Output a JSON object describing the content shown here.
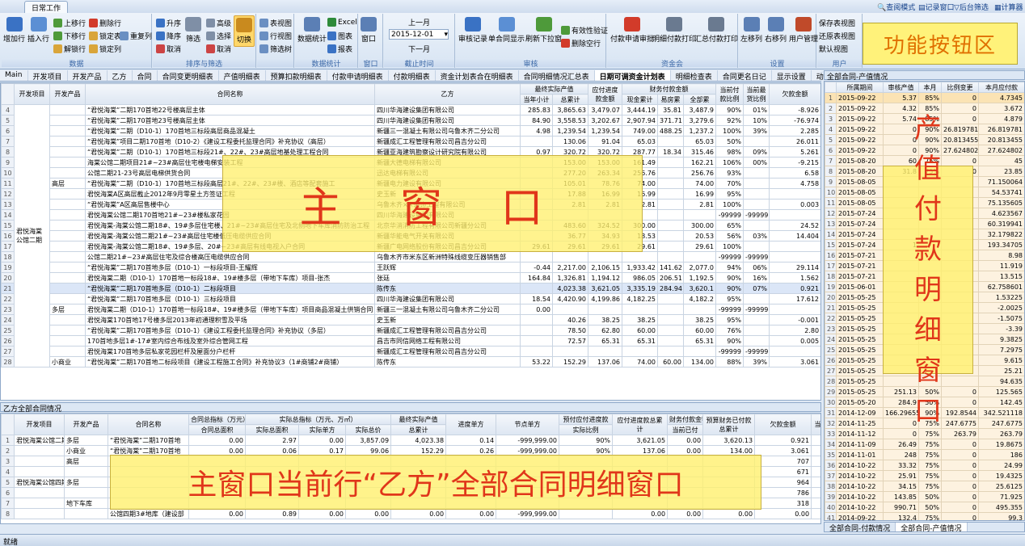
{
  "ribbon": {
    "tab": "日常工作",
    "quick": [
      "查阅模式",
      "记录窗口",
      "后台筛选",
      "计算器"
    ],
    "groups": [
      {
        "label": "数据",
        "buttons": [
          "增加行",
          "插入行",
          "上移行",
          "下移行",
          "解锁行",
          "删除行",
          "锁定表",
          "重复列",
          "锁定列"
        ]
      },
      {
        "label": "排序与筛选",
        "buttons": [
          "升序",
          "降序",
          "取消",
          "筛选",
          "取消",
          "高级",
          "选择",
          "取消",
          "切换"
        ]
      },
      {
        "label": "",
        "buttons": [
          "表视图",
          "行视图",
          "筛选树"
        ]
      },
      {
        "label": "数据统计",
        "buttons": [
          "数据统计",
          "Excel",
          "图表",
          "报表"
        ]
      },
      {
        "label": "窗口",
        "buttons": [
          "窗口"
        ]
      },
      {
        "label": "截止时间",
        "buttons": [
          "上一月",
          "2015-12-01",
          "下一月"
        ]
      },
      {
        "label": "审核",
        "buttons": [
          "审核记录",
          "单合同显示",
          "刷新下拉窗",
          "有效性验证",
          "删除空行"
        ]
      },
      {
        "label": "资金会",
        "buttons": [
          "付款申请审批",
          "明细付款打印",
          "汇总付款打印"
        ]
      },
      {
        "label": "设置",
        "buttons": [
          "左移列",
          "右移列",
          "用户管理"
        ]
      },
      {
        "label": "用户",
        "buttons": [
          "保存表视图",
          "还原表视图",
          "默认视图"
        ]
      }
    ],
    "zone_label": "功能按钮区"
  },
  "module_tabs": [
    "Main",
    "开发项目",
    "开发产品",
    "乙方",
    "合同",
    "合同变更明细表",
    "产值明细表",
    "预算扣款明细表",
    "付款申请明细表",
    "付款明细表",
    "资金计划表合在明细表",
    "合同明细情况汇总表",
    "日期可调资金计划表",
    "明细检查表",
    "合同更名日记",
    "显示设置",
    "动态更新下拉目…"
  ],
  "main": {
    "zone_label": "主 窗 口",
    "headers": {
      "project": "开发项目",
      "product": "开发产品",
      "contract": "合同名称",
      "partyb": "乙方",
      "output": "最终实际产值",
      "output_cur": "当年小计",
      "output_total": "总累计",
      "payable": "应付进度款金额",
      "fin": "财务付款金额",
      "fin_cash": "现金累计",
      "fin_easy": "易房累",
      "fin_total": "全部累",
      "ratio": "当前付款比例",
      "pre": "当前最货比例",
      "owed": "欠款金额"
    },
    "project": "君悦海棠公馆二期",
    "rows": [
      {
        "n": "4",
        "product": "",
        "contract": "“君悦海棠”二期170首地22号楼高层主体",
        "partyb": "四川华海建设集团有限公司",
        "cur": "285.83",
        "total": "3,865.63",
        "pay": "3,479.07",
        "cash": "3,444.19",
        "easy": "35.81",
        "all": "3,487.9",
        "ratio": "90%",
        "pre": "01%",
        "owed": "-8.926"
      },
      {
        "n": "5",
        "product": "",
        "contract": "“君悦海棠”二期170首地23号楼高层主体",
        "partyb": "四川华海建设集团有限公司",
        "cur": "84.90",
        "total": "3,558.53",
        "pay": "3,202.67",
        "cash": "2,907.94",
        "easy": "371.71",
        "all": "3,279.6",
        "ratio": "92%",
        "pre": "10%",
        "owed": "-76.974"
      },
      {
        "n": "6",
        "product": "",
        "contract": "“君悦海棠”二期（D10-1）170首地三标段高层商品混凝土",
        "partyb": "新疆三一混凝土有限公司乌鲁木齐二分公司",
        "cur": "4.98",
        "total": "1,239.54",
        "pay": "1,239.54",
        "cash": "749.00",
        "easy": "488.25",
        "all": "1,237.2",
        "ratio": "100%",
        "pre": "39%",
        "owed": "2.285"
      },
      {
        "n": "7",
        "product": "",
        "contract": "“君悦海棠”项目二期170首地（D10-2）《建设工程委托监理合同》补充协议（高层）",
        "partyb": "新疆成汇工程管理有限公司昌吉分公司",
        "cur": "",
        "total": "130.06",
        "pay": "91.04",
        "cash": "65.03",
        "easy": "",
        "all": "65.03",
        "ratio": "50%",
        "pre": "",
        "owed": "26.011"
      },
      {
        "n": "8",
        "product": "",
        "contract": "“君悦海棠”二期（D10-1）170首地三标段21#、22#、23#高层地基处理工程合同",
        "partyb": "新疆亚海建筑勘察设计研究院有限公司",
        "cur": "0.97",
        "total": "320.72",
        "pay": "320.72",
        "cash": "287.77",
        "easy": "18.34",
        "all": "315.46",
        "ratio": "98%",
        "pre": "09%",
        "owed": "5.261"
      },
      {
        "n": "9",
        "product": "",
        "contract": "海棠公馆二期项目21#~23#高层住宅楼电梯安装工程",
        "partyb": "新疆大德电梯有限公司",
        "cur": "",
        "total": "153.00",
        "pay": "153.00",
        "cash": "161.49",
        "easy": "",
        "all": "162.21",
        "ratio": "106%",
        "pre": "00%",
        "owed": "-9.215"
      },
      {
        "n": "10",
        "product": "",
        "contract": "公馆二期21-23号高层电梯供货合同",
        "partyb": "迅达电梯有限公司",
        "cur": "",
        "total": "277.20",
        "pay": "263.34",
        "cash": "256.76",
        "easy": "",
        "all": "256.76",
        "ratio": "93%",
        "pre": "",
        "owed": "6.58"
      },
      {
        "n": "11",
        "product": "高层",
        "contract": "“君悦海棠”二期（D10-1）170首地三标段高层21#、22#、23#楼、酒店等配套施工",
        "partyb": "新疆电力建设有限公司",
        "cur": "",
        "total": "105.01",
        "pay": "78.76",
        "cash": "74.00",
        "easy": "",
        "all": "74.00",
        "ratio": "70%",
        "pre": "",
        "owed": "4.758"
      },
      {
        "n": "12",
        "product": "",
        "contract": "君悦海棠A区高层截止2012年9月零星土方签证工程",
        "partyb": "史玉新",
        "cur": "",
        "total": "17.88",
        "pay": "16.99",
        "cash": "16.99",
        "easy": "",
        "all": "16.99",
        "ratio": "95%",
        "pre": "",
        "owed": ""
      },
      {
        "n": "13",
        "product": "",
        "contract": "“君悦海棠”A区高层售楼中心",
        "partyb": "乌鲁木齐××装饰工程有限公司",
        "cur": "",
        "total": "2.81",
        "pay": "2.81",
        "cash": "2.81",
        "easy": "",
        "all": "2.81",
        "ratio": "100%",
        "pre": "",
        "owed": "0.003"
      },
      {
        "n": "14",
        "product": "",
        "contract": "君悦海棠公馆二期170首地21#~23#楼私家花园",
        "partyb": "四川华海建设集团有限公司",
        "cur": "",
        "total": "",
        "pay": "",
        "cash": "",
        "easy": "",
        "all": "",
        "ratio": "-99999",
        "pre": "-99999",
        "owed": ""
      },
      {
        "n": "15",
        "product": "",
        "contract": "君悦海棠-海棠公馆二期18#、19#多层住宅楼、21#~23#高层住宅及北侧地下车库消防防治工程",
        "partyb": "北京华消消防工程有限公司新疆分公司",
        "cur": "",
        "total": "483.60",
        "pay": "324.52",
        "cash": "300.00",
        "easy": "",
        "all": "300.00",
        "ratio": "65%",
        "pre": "",
        "owed": "24.52"
      },
      {
        "n": "16",
        "product": "",
        "contract": "君悦海棠-海棠公馆二期21#~23#高层住宅楼低压电缆供应合同",
        "partyb": "新疆华能电气开关有限公司",
        "cur": "",
        "total": "36.77",
        "pay": "34.93",
        "cash": "18.53",
        "easy": "",
        "all": "20.53",
        "ratio": "56%",
        "pre": "03%",
        "owed": "14.404"
      },
      {
        "n": "17",
        "product": "",
        "contract": "君悦海棠-海棠公馆二期18#、19#多层、20#~23#高层有线电视入户合同",
        "partyb": "新疆广电网络股份有限公司昌吉分公司",
        "cur": "29.61",
        "total": "29.61",
        "pay": "29.61",
        "cash": "29.61",
        "easy": "",
        "all": "29.61",
        "ratio": "100%",
        "pre": "",
        "owed": ""
      },
      {
        "n": "18",
        "product": "",
        "contract": "公馆二期21#~23#高层住宅及综合楼高压电缆供应合同",
        "partyb": "乌鲁木齐市米东区新洲特殊线缆变压器销售部",
        "cur": "",
        "total": "",
        "pay": "",
        "cash": "",
        "easy": "",
        "all": "",
        "ratio": "-99999",
        "pre": "-99999",
        "owed": ""
      },
      {
        "n": "19",
        "product": "",
        "contract": "“君悦海棠”二期170首地多层（D10-1）一标段项目-王耀辉",
        "partyb": "王跃辉",
        "cur": "-0.44",
        "total": "2,217.00",
        "pay": "2,106.15",
        "cash": "1,933.42",
        "easy": "141.62",
        "all": "2,077.0",
        "ratio": "94%",
        "pre": "06%",
        "owed": "29.114"
      },
      {
        "n": "20",
        "product": "",
        "contract": "君悦海棠二期（D10-1）170首地一标段18#、19#楼多层（带地下车库）项目-张杰",
        "partyb": "张廷",
        "cur": "164.84",
        "total": "1,326.81",
        "pay": "1,194.12",
        "cash": "986.05",
        "easy": "206.51",
        "all": "1,192.5",
        "ratio": "90%",
        "pre": "16%",
        "owed": "1.562"
      },
      {
        "n": "21",
        "product": "",
        "contract": "“君悦海棠”二期170首地多层（D10-1）二标段项目",
        "partyb": "陈传东",
        "cur": "",
        "total": "4,023.38",
        "pay": "3,621.05",
        "cash": "3,335.19",
        "easy": "284.94",
        "all": "3,620.1",
        "ratio": "90%",
        "pre": "07%",
        "owed": "0.921",
        "sel": true
      },
      {
        "n": "22",
        "product": "",
        "contract": "“君悦海棠”二期170首地多层（D10-1）三标段项目",
        "partyb": "四川华海建设集团有限公司",
        "cur": "18.54",
        "total": "4,420.90",
        "pay": "4,199.86",
        "cash": "4,182.25",
        "easy": "",
        "all": "4,182.2",
        "ratio": "95%",
        "pre": "",
        "owed": "17.612"
      },
      {
        "n": "23",
        "product": "多层",
        "contract": "君悦海棠二期（D10-1）170首地一标段18#、19#楼多层（带地下车库）项目商品混凝土供销合同",
        "partyb": "新疆三一混凝土有限公司乌鲁木齐二分公司",
        "cur": "0.00",
        "total": "",
        "pay": "",
        "cash": "",
        "easy": "",
        "all": "",
        "ratio": "-99999",
        "pre": "-99999",
        "owed": ""
      },
      {
        "n": "24",
        "product": "",
        "contract": "君悦海棠170首地17号楼多层2013年初通理积雪及平场",
        "partyb": "史玉新",
        "cur": "",
        "total": "40.26",
        "pay": "38.25",
        "cash": "38.25",
        "easy": "",
        "all": "38.25",
        "ratio": "95%",
        "pre": "",
        "owed": "-0.001"
      },
      {
        "n": "25",
        "product": "",
        "contract": "“君悦海棠”二期170首地多层（D10-1）《建设工程委托监理合同》补充协议（多层）",
        "partyb": "新疆成汇工程管理有限公司昌吉分公司",
        "cur": "",
        "total": "78.50",
        "pay": "62.80",
        "cash": "60.00",
        "easy": "",
        "all": "60.00",
        "ratio": "76%",
        "pre": "",
        "owed": "2.80"
      },
      {
        "n": "26",
        "product": "",
        "contract": "170首地多层1#-17#室内综合布线及室外综合管网工程",
        "partyb": "昌吉市同信网络工程有限公司",
        "cur": "",
        "total": "72.57",
        "pay": "65.31",
        "cash": "65.31",
        "easy": "",
        "all": "65.31",
        "ratio": "90%",
        "pre": "",
        "owed": "0.005"
      },
      {
        "n": "27",
        "product": "",
        "contract": "君悦海棠170首地多层私家花园栏杆及屋面分户栏杆",
        "partyb": "新疆成汇工程管理有限公司昌吉分公司",
        "cur": "",
        "total": "",
        "pay": "",
        "cash": "",
        "easy": "",
        "all": "",
        "ratio": "-99999",
        "pre": "-99999",
        "owed": ""
      },
      {
        "n": "28",
        "product": "小商业",
        "contract": "“君悦海棠”二期170首地二标段项目《建设工程施工合同》补充协议3（1#商铺2#商铺）",
        "partyb": "陈传东",
        "cur": "53.22",
        "total": "152.29",
        "pay": "137.06",
        "cash": "74.00",
        "easy": "60.00",
        "all": "134.00",
        "ratio": "88%",
        "pre": "39%",
        "owed": "3.061"
      }
    ]
  },
  "bottom": {
    "title": "乙方全部合同情况",
    "zone_label": "主窗口当前行“乙方”全部合同明细窗口",
    "headers": [
      "开发项目",
      "开发产品",
      "合同名称",
      "合同总指标（万元）",
      "实际总指标（万元、万㎡）",
      "最终实际产值",
      "进度单方",
      "节点单方",
      "预付应付进度款",
      "应付进度款总累计",
      "财务付款金额",
      "预算财务已付款总累计",
      "欠款金额",
      "当前付"
    ],
    "subheaders": [
      "合同总面积",
      "实际总面积",
      "实际单方",
      "实际总价",
      "总累计",
      "实际比例",
      "当前已付",
      "当年已付"
    ],
    "rows": [
      {
        "p": "君悦海棠公馆二期",
        "prod": "多层",
        "c": "“君悦海棠”二期170首地",
        "a": "0.00",
        "b": "2.97",
        "d": "0.00",
        "e": "3,857.09",
        "f": "4,023.38",
        "g": "0.14",
        "h": "-999,999.00",
        "i": "90%",
        "j": "3,621.05",
        "k": "0.00",
        "l": "3,620.13",
        "m": "0.921"
      },
      {
        "p": "",
        "prod": "小商业",
        "c": "“君悦海棠”二期170首地",
        "a": "0.00",
        "b": "0.06",
        "d": "0.17",
        "e": "99.06",
        "f": "152.29",
        "g": "0.26",
        "h": "-999,999.00",
        "i": "90%",
        "j": "137.06",
        "k": "0.00",
        "l": "134.00",
        "m": "3.061"
      },
      {
        "p": "",
        "prod": "高层",
        "c": "",
        "a": "",
        "b": "",
        "d": "",
        "e": "",
        "f": "",
        "g": "",
        "h": "",
        "i": "",
        "j": "",
        "k": "",
        "l": "",
        "m": "707"
      },
      {
        "p": "",
        "prod": "",
        "c": "",
        "a": "",
        "b": "",
        "d": "",
        "e": "",
        "f": "",
        "g": "",
        "h": "",
        "i": "",
        "j": "",
        "k": "",
        "l": "",
        "m": "671"
      },
      {
        "p": "君悦海棠公馆四期",
        "prod": "多层",
        "c": "",
        "a": "",
        "b": "",
        "d": "",
        "e": "",
        "f": "",
        "g": "",
        "h": "",
        "i": "",
        "j": "",
        "k": "",
        "l": "",
        "m": "964"
      },
      {
        "p": "",
        "prod": "",
        "c": "",
        "a": "",
        "b": "",
        "d": "",
        "e": "",
        "f": "",
        "g": "",
        "h": "",
        "i": "",
        "j": "",
        "k": "",
        "l": "",
        "m": "786"
      },
      {
        "p": "",
        "prod": "地下车库",
        "c": "",
        "a": "",
        "b": "",
        "d": "",
        "e": "",
        "f": "",
        "g": "",
        "h": "",
        "i": "",
        "j": "",
        "k": "",
        "l": "",
        "m": "318"
      },
      {
        "p": "",
        "prod": "",
        "c": "公馆四期3#地库（建设部",
        "a": "0.00",
        "b": "0.89",
        "d": "0.00",
        "e": "0.00",
        "f": "0.00",
        "g": "0.00",
        "h": "-999,999.00",
        "i": "",
        "j": "0.00",
        "k": "0.00",
        "l": "0.00",
        "m": "0.00"
      }
    ]
  },
  "right": {
    "title": "全部合同-产值情况",
    "headers": [
      "所属期间",
      "审核产值",
      "本月",
      "比例变更",
      "本月应付款"
    ],
    "zone_label": [
      "产",
      "值",
      "付",
      "款",
      "明",
      "细",
      "窗",
      "口"
    ],
    "rows": [
      [
        "2015-09-22",
        "5.37",
        "85%",
        "0",
        "4.7345"
      ],
      [
        "2015-09-22",
        "4.32",
        "85%",
        "0",
        "3.672"
      ],
      [
        "2015-09-22",
        "5.74",
        "85%",
        "0",
        "4.879"
      ],
      [
        "2015-09-22",
        "0",
        "90%",
        "26.819781",
        "26.819781"
      ],
      [
        "2015-09-22",
        "0",
        "90%",
        "20.813455",
        "20.813455"
      ],
      [
        "2015-09-22",
        "0",
        "90%",
        "27.624802",
        "27.624802"
      ],
      [
        "2015-08-20",
        "60",
        "75%",
        "0",
        "45"
      ],
      [
        "2015-08-20",
        "31.8",
        "75%",
        "0",
        "23.85"
      ],
      [
        "2015-08-05",
        "",
        "",
        "",
        "71.150064"
      ],
      [
        "2015-08-05",
        "",
        "",
        "",
        "54.53741"
      ],
      [
        "2015-08-05",
        "",
        "",
        "",
        "75.135605"
      ],
      [
        "2015-07-24",
        "",
        "",
        "",
        "4.623567"
      ],
      [
        "2015-07-24",
        "",
        "",
        "",
        "60.319941"
      ],
      [
        "2015-07-24",
        "",
        "",
        "",
        "32.179822"
      ],
      [
        "2015-07-24",
        "1",
        "",
        "",
        "193.34705"
      ],
      [
        "2015-07-21",
        "",
        "",
        "",
        "8.98"
      ],
      [
        "2015-07-21",
        "",
        "",
        "",
        "11.919"
      ],
      [
        "2015-07-21",
        "",
        "",
        "",
        "13.515"
      ],
      [
        "2015-06-01",
        "",
        "",
        "",
        "62.758601"
      ],
      [
        "2015-05-25",
        "",
        "",
        "",
        "1.53225"
      ],
      [
        "2015-05-25",
        "",
        "",
        "",
        "-2.0025"
      ],
      [
        "2015-05-25",
        "",
        "",
        "",
        "-1.5075"
      ],
      [
        "2015-05-25",
        "",
        "",
        "",
        "-3.39"
      ],
      [
        "2015-05-25",
        "",
        "",
        "",
        "9.3825"
      ],
      [
        "2015-05-25",
        "",
        "",
        "",
        "7.2975"
      ],
      [
        "2015-05-25",
        "",
        "",
        "",
        "9.615"
      ],
      [
        "2015-05-25",
        "",
        "",
        "",
        "25.21"
      ],
      [
        "2015-05-25",
        "",
        "",
        "",
        "94.635"
      ],
      [
        "2015-05-25",
        "251.13",
        "50%",
        "0",
        "125.565"
      ],
      [
        "2015-05-20",
        "284.9",
        "50%",
        "0",
        "142.45"
      ],
      [
        "2014-12-09",
        "166.296553",
        "90%",
        "192.8544",
        "342.521118"
      ],
      [
        "2014-11-25",
        "0",
        "75%",
        "247.6775",
        "247.6775"
      ],
      [
        "2014-11-12",
        "0",
        "75%",
        "263.79",
        "263.79"
      ],
      [
        "2014-11-09",
        "26.49",
        "75%",
        "0",
        "19.8675"
      ],
      [
        "2014-11-01",
        "248",
        "75%",
        "0",
        "186"
      ],
      [
        "2014-10-22",
        "33.32",
        "75%",
        "0",
        "24.99"
      ],
      [
        "2014-10-22",
        "25.91",
        "75%",
        "0",
        "19.4325"
      ],
      [
        "2014-10-22",
        "34.15",
        "75%",
        "0",
        "25.6125"
      ],
      [
        "2014-10-22",
        "143.85",
        "50%",
        "0",
        "71.925"
      ],
      [
        "2014-10-22",
        "990.71",
        "50%",
        "0",
        "495.355"
      ],
      [
        "2014-09-22",
        "132.4",
        "75%",
        "0",
        "99.3"
      ],
      [
        "2014-09-22",
        "102.97",
        "75%",
        "0",
        "77.2275"
      ],
      [
        "2014-09-22",
        "20",
        "75%",
        "0",
        "15"
      ]
    ],
    "tabs": [
      "全部合同-付款情况",
      "全部合同-产值情况"
    ]
  },
  "status": "就绪"
}
